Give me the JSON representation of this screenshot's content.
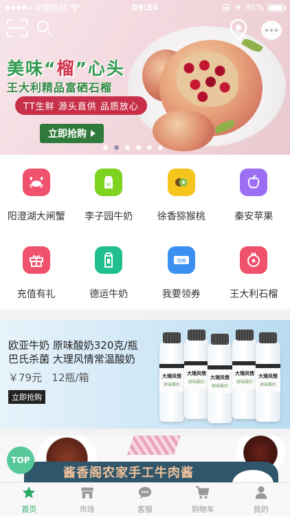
{
  "status_bar": {
    "carrier": "中国移动",
    "time": "09:34",
    "battery": "95%",
    "battery_level": 0.95
  },
  "header": {
    "scan_icon": "scan-icon",
    "search_icon": "search-icon",
    "location_icon": "location-pin-icon",
    "message_icon": "chat-bubble-icon"
  },
  "banner": {
    "title_part1": "美味“",
    "title_highlight": "榴",
    "title_part2": "”心头",
    "subtitle": "王大利精品富硒石榴",
    "tag": "TT生鲜  源头直供  品质放心",
    "cta": "立即抢购",
    "slide_count": 6,
    "active_slide": 2
  },
  "quick_menu": [
    {
      "label": "阳澄湖大闸蟹",
      "icon": "crab-icon",
      "color": "#f0516d"
    },
    {
      "label": "李子园牛奶",
      "icon": "milk-box-icon",
      "color": "#7ed321"
    },
    {
      "label": "徐香猕猴桃",
      "icon": "kiwi-icon",
      "color": "#f5c51e"
    },
    {
      "label": "秦安苹果",
      "icon": "apple-icon",
      "color": "#9b6ef3"
    },
    {
      "label": "充值有礼",
      "icon": "gift-icon",
      "color": "#f0516d"
    },
    {
      "label": "德运牛奶",
      "icon": "milk-carton-icon",
      "color": "#1fc08e"
    },
    {
      "label": "我要领券",
      "icon": "coupon-icon",
      "color": "#3b8ff0"
    },
    {
      "label": "王大利石榴",
      "icon": "pomegranate-icon",
      "color": "#f0516d"
    }
  ],
  "promo_milk": {
    "line1": "欧亚牛奶 原味酸奶320克/瓶",
    "line2": "巴氏杀菌 大理风情常温酸奶",
    "price": "￥79元",
    "unit": "12瓶/箱",
    "cta": "立即抢购",
    "bottle_label_1": "大理风情",
    "bottle_label_2": "原味酸奶"
  },
  "promo_meat": {
    "text": "酱香阁农家手工牛肉酱"
  },
  "top_button": "TOP",
  "tabs": [
    {
      "label": "首页",
      "icon": "star-icon",
      "active": true
    },
    {
      "label": "市场",
      "icon": "store-icon",
      "active": false
    },
    {
      "label": "客服",
      "icon": "chat-icon",
      "active": false
    },
    {
      "label": "购物车",
      "icon": "cart-icon",
      "active": false
    },
    {
      "label": "我的",
      "icon": "user-icon",
      "active": false
    }
  ]
}
